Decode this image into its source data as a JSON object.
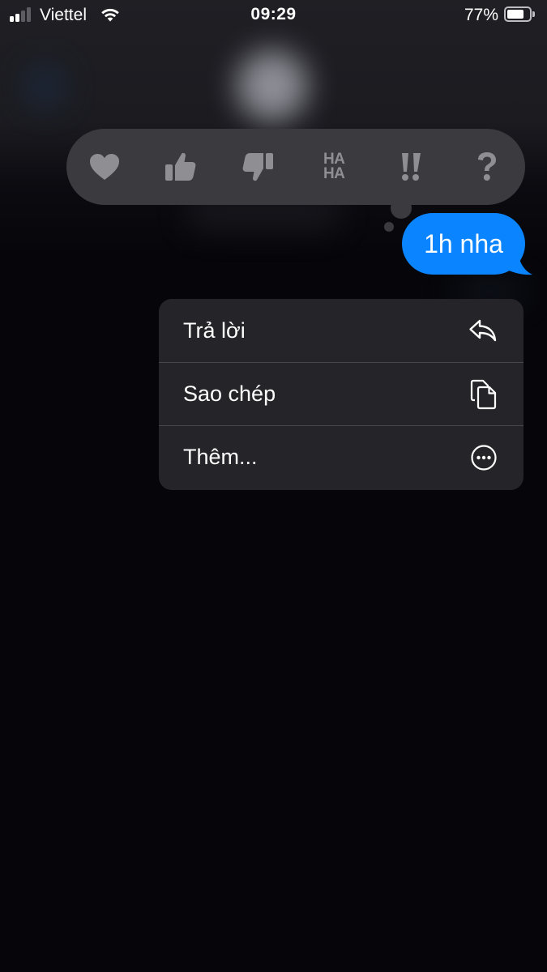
{
  "status_bar": {
    "carrier": "Viettel",
    "time": "09:29",
    "battery_percent": "77%",
    "battery_level": 0.77,
    "signal_bars_active": 2,
    "signal_bars_total": 4
  },
  "tapbacks": [
    {
      "name": "heart",
      "icon": "heart-icon"
    },
    {
      "name": "thumbs-up",
      "icon": "thumbs-up-icon"
    },
    {
      "name": "thumbs-down",
      "icon": "thumbs-down-icon"
    },
    {
      "name": "haha",
      "icon": "haha-icon",
      "label_top": "HA",
      "label_bottom": "HA"
    },
    {
      "name": "emphasize",
      "icon": "double-exclamation-icon"
    },
    {
      "name": "question",
      "icon": "question-mark-icon"
    }
  ],
  "message": {
    "text": "1h nha",
    "color": "#0b84ff"
  },
  "menu": {
    "items": [
      {
        "label": "Trả lời",
        "icon": "reply-icon"
      },
      {
        "label": "Sao chép",
        "icon": "copy-icon"
      },
      {
        "label": "Thêm...",
        "icon": "more-icon"
      }
    ]
  },
  "colors": {
    "tapback_icon": "#8e8e93",
    "menu_background": "#252529",
    "background": "#06060a"
  }
}
